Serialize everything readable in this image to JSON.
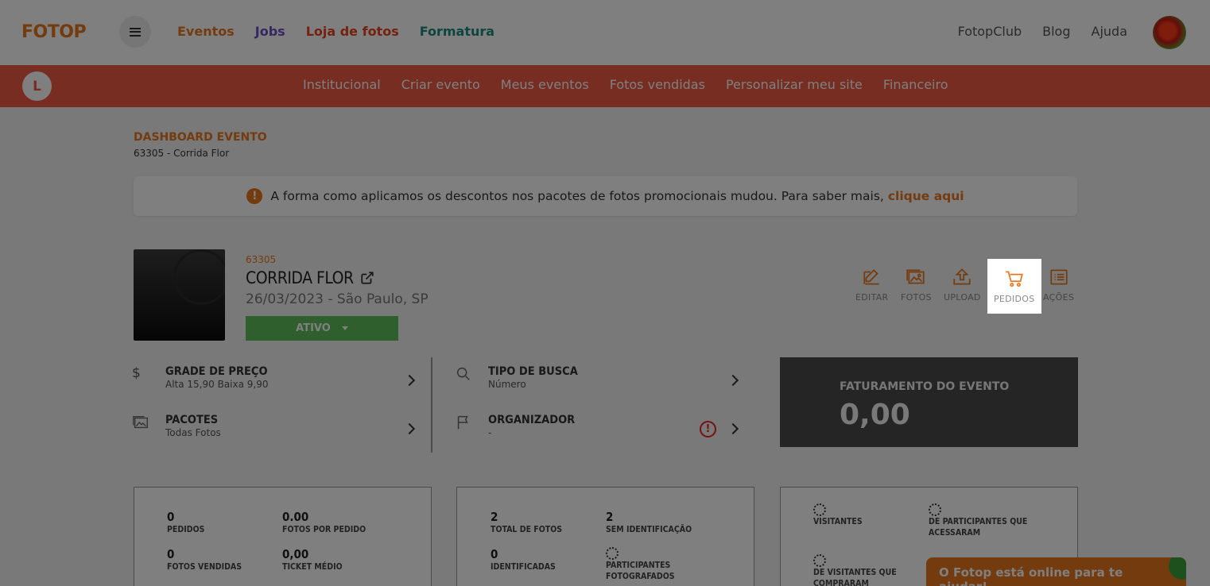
{
  "header": {
    "logo": "FOTOP",
    "nav": [
      {
        "label": "Eventos",
        "color": "#e8771e"
      },
      {
        "label": "Jobs",
        "color": "#6b4fc2"
      },
      {
        "label": "Loja de fotos",
        "color": "#e8421e"
      },
      {
        "label": "Formatura",
        "color": "#1b8a7e"
      }
    ],
    "right_nav": [
      "FotopClub",
      "Blog",
      "Ajuda"
    ]
  },
  "subnav": {
    "user_initial": "L",
    "items": [
      "Institucional",
      "Criar evento",
      "Meus eventos",
      "Fotos vendidas",
      "Personalizar meu site",
      "Financeiro"
    ]
  },
  "breadcrumb": {
    "title": "DASHBOARD EVENTO",
    "subtitle": "63305 - Corrida Flor"
  },
  "notice": {
    "text": "A forma como aplicamos os descontos nos pacotes de fotos promocionais mudou. Para saber mais,",
    "link": "clique aqui"
  },
  "event": {
    "id": "63305",
    "name": "CORRIDA FLOR",
    "date_location": "26/03/2023 - São Paulo, SP",
    "status": "ATIVO"
  },
  "actions": {
    "edit": "EDITAR",
    "photos": "FOTOS",
    "upload": "UPLOAD",
    "orders": "PEDIDOS",
    "more": "AÇÕES"
  },
  "info": {
    "price_grid": {
      "label": "GRADE DE PREÇO",
      "value": "Alta 15,90 Baixa 9,90"
    },
    "packages": {
      "label": "PACOTES",
      "value": "Todas Fotos"
    },
    "search_type": {
      "label": "TIPO DE BUSCA",
      "value": "Número"
    },
    "organizer": {
      "label": "ORGANIZADOR",
      "value": "-"
    }
  },
  "revenue": {
    "title": "FATURAMENTO DO EVENTO",
    "value": "0,00"
  },
  "cards": {
    "sales": {
      "orders_n": "0",
      "orders_l": "PEDIDOS",
      "ppo_n": "0.00",
      "ppo_l": "FOTOS POR PEDIDO",
      "sold_n": "0",
      "sold_l": "FOTOS VENDIDAS",
      "ticket_n": "0,00",
      "ticket_l": "TICKET MÉDIO"
    },
    "photos": {
      "total_n": "2",
      "total_l": "TOTAL DE FOTOS",
      "noid_n": "2",
      "noid_l": "SEM IDENTIFICAÇÃO",
      "ided_n": "0",
      "ided_l": "IDENTIFICADAS",
      "photographed_l": "PARTICIPANTES FOTOGRAFADOS"
    },
    "visitors": {
      "visitors_l": "VISITANTES",
      "accessed_l": "DE PARTICIPANTES QUE ACESSARAM",
      "bought_l": "DE VISITANTES QUE COMPRARAM"
    }
  },
  "chat": {
    "text": "O Fotop está online para te ajudar!"
  }
}
